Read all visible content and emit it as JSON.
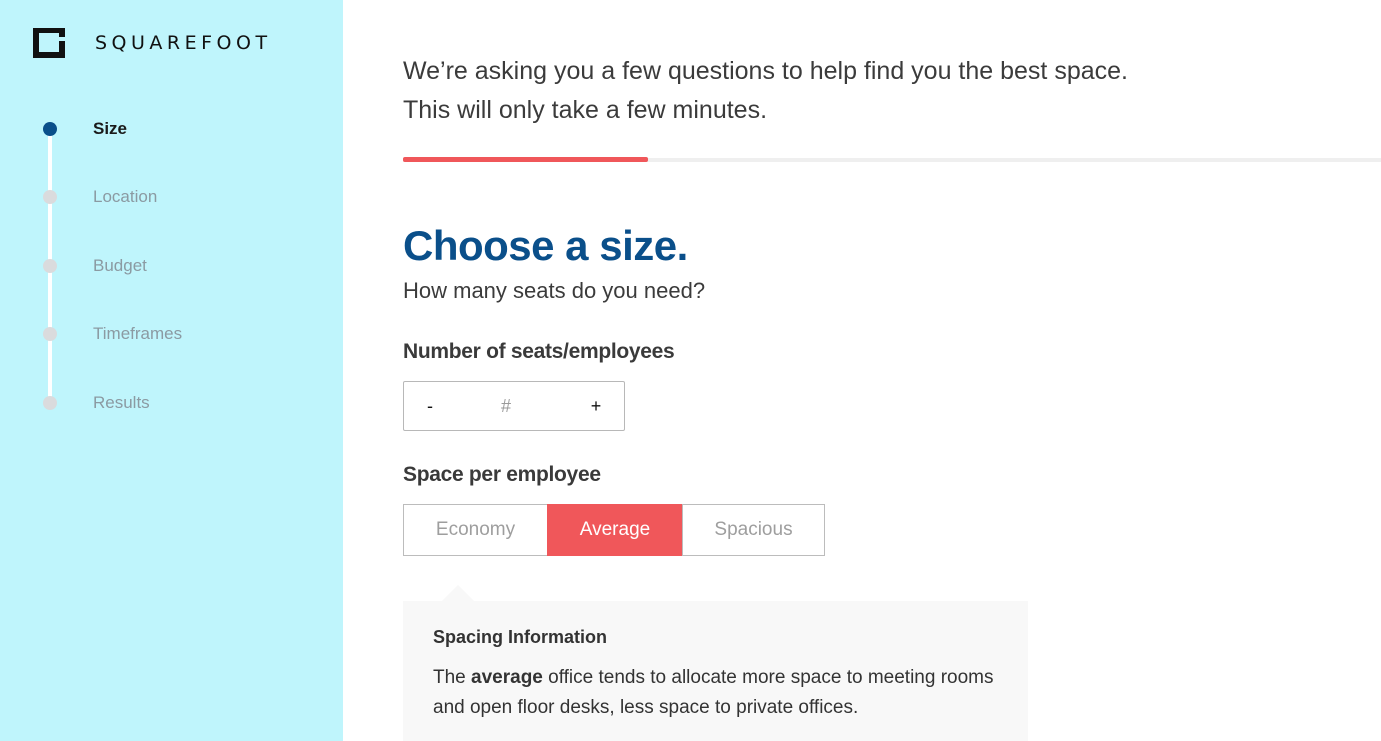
{
  "brand": {
    "name": "SQUAREFOOT",
    "logo_icon": "squarefoot-logo-icon"
  },
  "colors": {
    "sidebar_bg": "#bff5fc",
    "accent": "#f0575a",
    "primary": "#0a4f8a"
  },
  "steps": [
    {
      "label": "Size",
      "active": true
    },
    {
      "label": "Location",
      "active": false
    },
    {
      "label": "Budget",
      "active": false
    },
    {
      "label": "Timeframes",
      "active": false
    },
    {
      "label": "Results",
      "active": false
    }
  ],
  "intro": {
    "line1": "We’re asking you a few questions to help find you the best space.",
    "line2": "This will only take a few minutes."
  },
  "progress": {
    "fraction": 0.25
  },
  "main": {
    "title": "Choose a size.",
    "subtitle": "How many seats do you need?"
  },
  "seats": {
    "label": "Number of seats/employees",
    "minus_label": "-",
    "plus_label": "+",
    "placeholder": "#",
    "value": ""
  },
  "space": {
    "label": "Space per employee",
    "options": [
      {
        "label": "Economy",
        "selected": false
      },
      {
        "label": "Average",
        "selected": true
      },
      {
        "label": "Spacious",
        "selected": false
      }
    ]
  },
  "info": {
    "title": "Spacing Information",
    "text_prefix": "The ",
    "text_bold": "average",
    "text_suffix": " office tends to allocate more space to meeting rooms and open floor desks, less space to private offices."
  }
}
